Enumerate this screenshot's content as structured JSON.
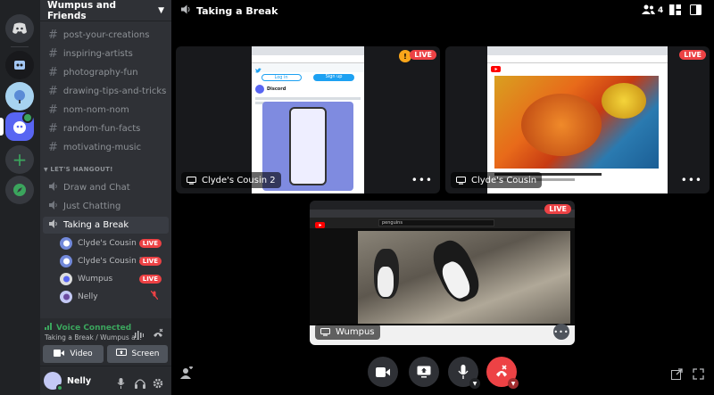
{
  "server": {
    "name": "Wumpus and Friends"
  },
  "text_channels": [
    {
      "label": "post-your-creations"
    },
    {
      "label": "inspiring-artists"
    },
    {
      "label": "photography-fun"
    },
    {
      "label": "drawing-tips-and-tricks"
    },
    {
      "label": "nom-nom-nom"
    },
    {
      "label": "random-fun-facts"
    },
    {
      "label": "motivating-music"
    }
  ],
  "category": "LET'S HANGOUT!",
  "voice_channels": [
    {
      "label": "Draw and Chat"
    },
    {
      "label": "Just Chatting"
    },
    {
      "label": "Taking a Break"
    }
  ],
  "voice_users": [
    {
      "name": "Clyde's Cousin",
      "badge": "LIVE"
    },
    {
      "name": "Clyde's Cousin 2",
      "badge": "LIVE"
    },
    {
      "name": "Wumpus",
      "badge": "LIVE"
    },
    {
      "name": "Nelly",
      "badge": ""
    }
  ],
  "voice_status": {
    "title": "Voice Connected",
    "subtitle": "Taking a Break / Wumpus a..."
  },
  "buttons": {
    "video": "Video",
    "screen": "Screen"
  },
  "user": {
    "name": "Nelly"
  },
  "header": {
    "channel": "Taking a Break",
    "member_count": "4"
  },
  "streams": [
    {
      "name": "Clyde's Cousin 2",
      "badge": "LIVE"
    },
    {
      "name": "Clyde's Cousin",
      "badge": "LIVE"
    },
    {
      "name": "Wumpus",
      "badge": "LIVE"
    }
  ],
  "stream_contents": {
    "twitter_post": "Discord",
    "twitter_buttons": [
      "Log in",
      "Sign up"
    ],
    "youtube_search": "penguins"
  },
  "colors": {
    "blurple": "#5865f2",
    "live": "#ed4245",
    "online": "#3ba55d",
    "sidebar": "#2f3136"
  }
}
